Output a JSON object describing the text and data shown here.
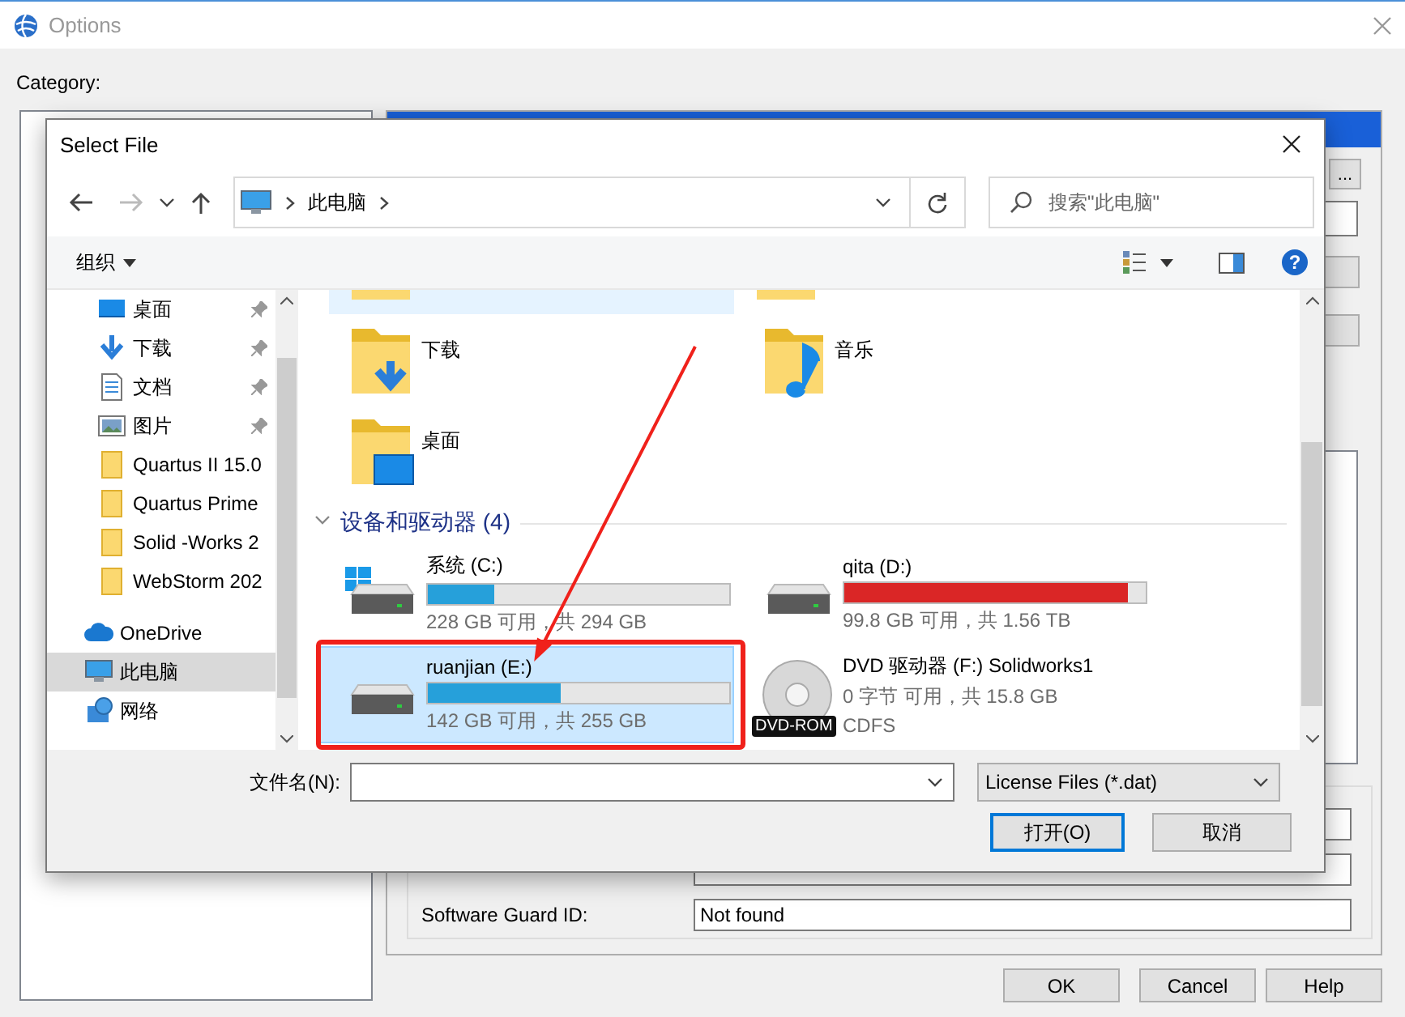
{
  "options": {
    "title": "Options",
    "category_label": "Category:",
    "browse_button": "...",
    "software_guard_label": "Software Guard ID:",
    "software_guard_value": "Not found",
    "buttons": [
      "OK",
      "Cancel",
      "Help"
    ]
  },
  "dialog": {
    "title": "Select File",
    "address": [
      "此电脑"
    ],
    "search_placeholder": "搜索\"此电脑\"",
    "organize": "组织",
    "help_glyph": "?",
    "quick_access": [
      {
        "label": "桌面",
        "pinned": true
      },
      {
        "label": "下载",
        "pinned": true
      },
      {
        "label": "文档",
        "pinned": true
      },
      {
        "label": "图片",
        "pinned": true
      },
      {
        "label": "Quartus II 15.0",
        "pinned": false
      },
      {
        "label": "Quartus Prime",
        "pinned": false
      },
      {
        "label": "Solid -Works 2",
        "pinned": false
      },
      {
        "label": "WebStorm 202",
        "pinned": false
      }
    ],
    "locations": [
      {
        "label": "OneDrive",
        "selected": false
      },
      {
        "label": "此电脑",
        "selected": true
      },
      {
        "label": "网络",
        "selected": false
      }
    ],
    "partial_row": [
      {
        "selected": true
      },
      {
        "selected": false
      }
    ],
    "folders": [
      {
        "label": "下载"
      },
      {
        "label": "音乐"
      },
      {
        "label": "桌面"
      }
    ],
    "group": {
      "label": "设备和驱动器 (4)",
      "expanded": true
    },
    "drives": [
      {
        "kind": "disk",
        "name": "系统 (C:)",
        "level": 0.22,
        "size": "228 GB 可用，共 294 GB",
        "selected": false
      },
      {
        "kind": "disk",
        "name": "qita (D:)",
        "level": 0.94,
        "size": "99.8 GB 可用，共 1.56 TB",
        "selected": false
      },
      {
        "kind": "disk",
        "name": "ruanjian (E:)",
        "level": 0.44,
        "size": "142 GB 可用，共 255 GB",
        "selected": true
      },
      {
        "kind": "disc",
        "name": "DVD 驱动器 (F:) Solidworks1",
        "size": "0 字节 可用，共 15.8 GB",
        "filesystem": "CDFS",
        "badge": "DVD-ROM",
        "selected": false
      }
    ],
    "filename_label": "文件名(N):",
    "file_type": "License Files (*.dat)",
    "open_button": "打开(O)",
    "cancel_button": "取消"
  },
  "annotation": {
    "kind": "arrow-and-box"
  }
}
